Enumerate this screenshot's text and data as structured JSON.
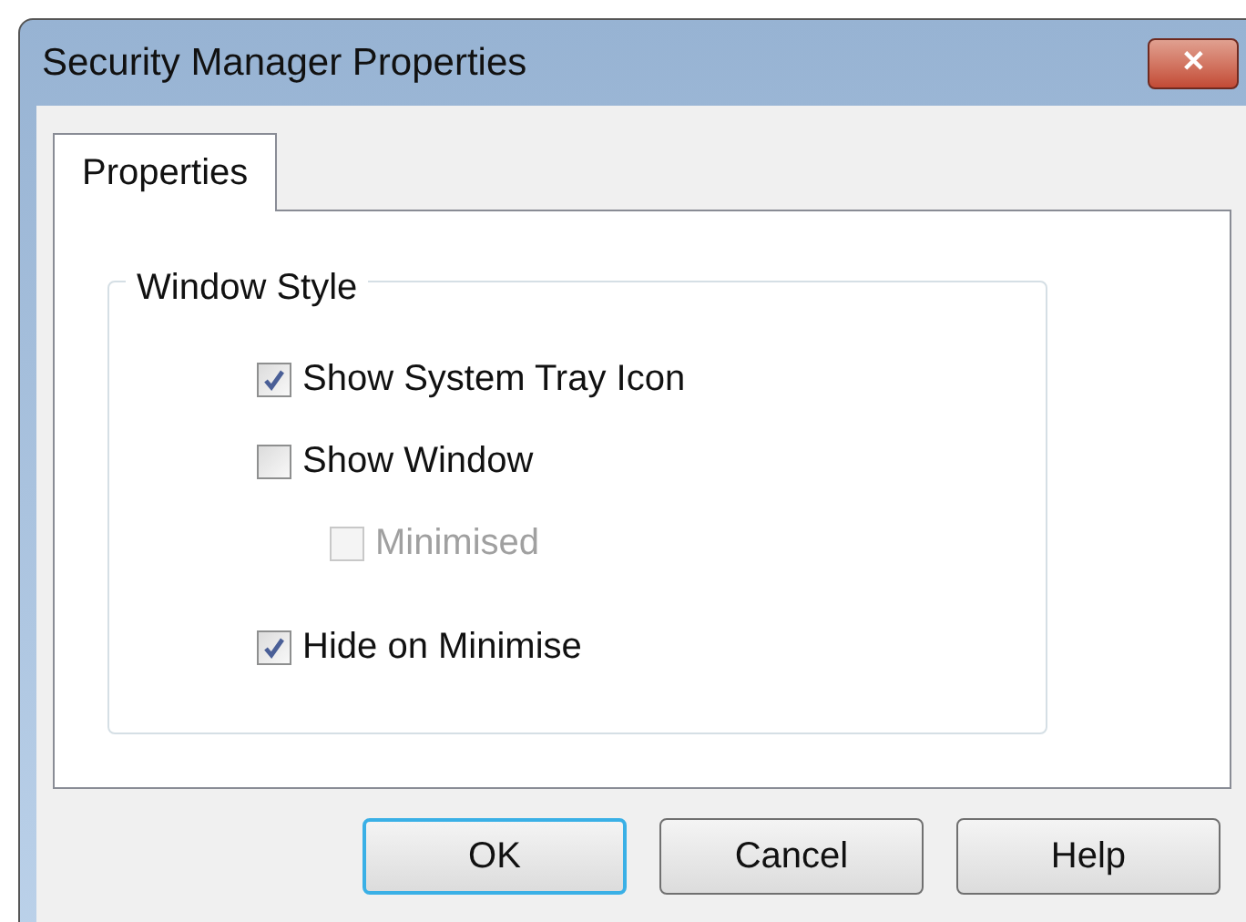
{
  "window": {
    "title": "Security Manager Properties",
    "close": "✕"
  },
  "tabs": [
    {
      "label": "Properties",
      "selected": true
    }
  ],
  "group": {
    "title": "Window Style",
    "options": [
      {
        "label": "Show System Tray Icon",
        "checked": true,
        "disabled": false
      },
      {
        "label": "Show Window",
        "checked": false,
        "disabled": false,
        "children": [
          {
            "label": "Minimised",
            "checked": false,
            "disabled": true
          }
        ]
      },
      {
        "label": "Hide on Minimise",
        "checked": true,
        "disabled": false
      }
    ]
  },
  "buttons": [
    {
      "label": "OK",
      "default": true
    },
    {
      "label": "Cancel",
      "default": false
    },
    {
      "label": "Help",
      "default": false
    }
  ]
}
